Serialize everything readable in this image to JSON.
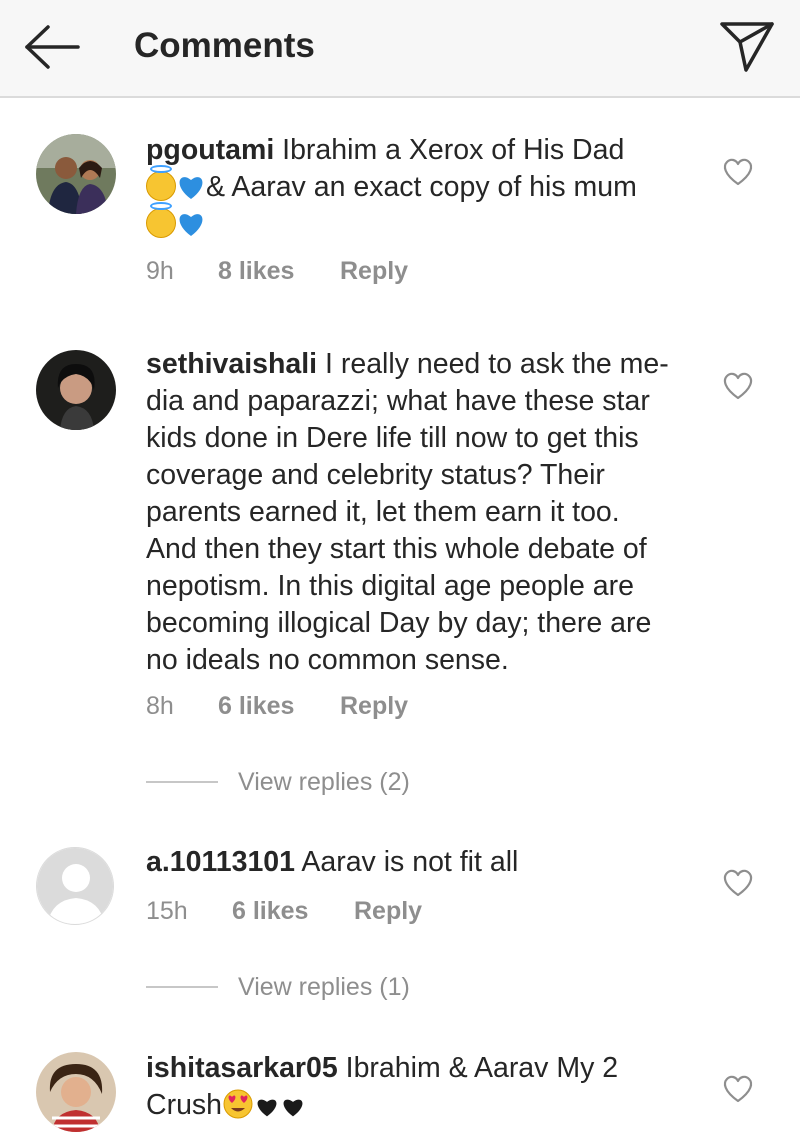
{
  "header": {
    "title": "Comments",
    "back_icon": "arrow-left-icon",
    "share_icon": "paper-plane-icon"
  },
  "comments": [
    {
      "username": "pgoutami",
      "text_1": " Ibrahim a Xerox of His Dad",
      "text_2": "& Aarav an exact copy of his mum",
      "time": "9h",
      "likes": "8 likes",
      "reply": "Reply"
    },
    {
      "username": "sethivaishali",
      "lines": [
        " I really need to ask the me-",
        "dia and paparazzi; what have these star",
        "kids done in Dere life till now to get this",
        "coverage and celebrity status? Their",
        "parents earned it, let them earn it too.",
        "And then they start this whole debate of",
        "nepotism. In this digital age people are",
        "becoming illogical Day by day; there are",
        "no ideals no common sense."
      ],
      "time": "8h",
      "likes": "6 likes",
      "reply": "Reply",
      "view_replies": "View replies (2)"
    },
    {
      "username": "a.10113101",
      "text": " Aarav is not fit all",
      "time": "15h",
      "likes": "6 likes",
      "reply": "Reply",
      "view_replies": "View replies (1)"
    },
    {
      "username": "ishitasarkar05",
      "text_1": " Ibrahim & Aarav My 2",
      "text_2": "Crush"
    }
  ],
  "colors": {
    "header_bg": "#f7f7f7",
    "text": "#262626",
    "meta": "#8e8e8e",
    "blue_heart": "#2d8fe0",
    "black_heart": "#1a1a1a"
  }
}
